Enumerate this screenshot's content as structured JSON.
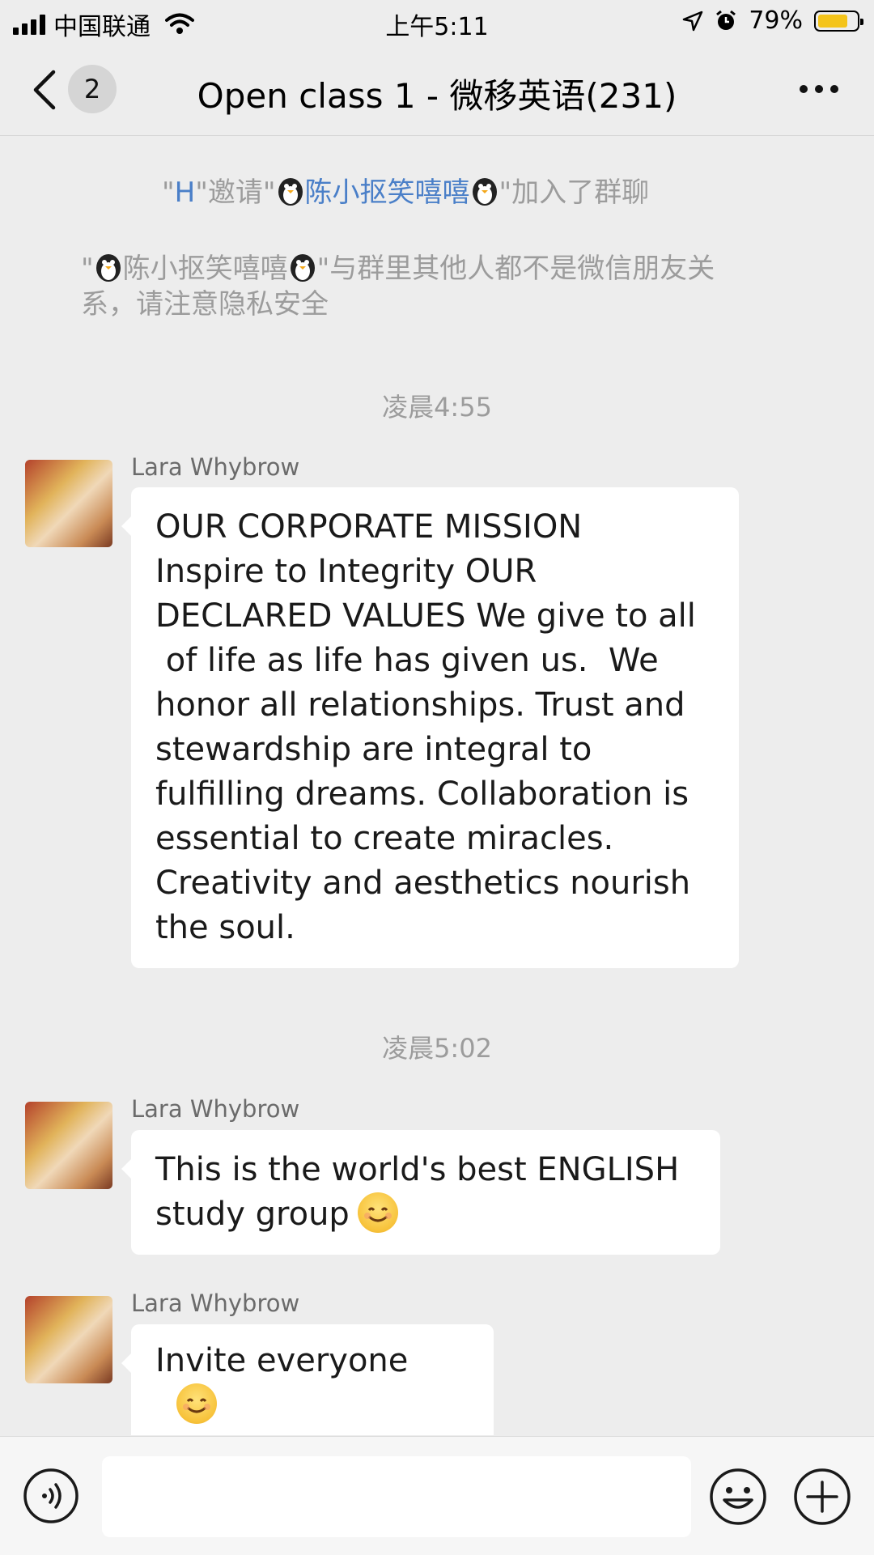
{
  "status_bar": {
    "carrier": "中国联通",
    "time": "上午5:11",
    "battery": "79%",
    "battery_level": 0.79
  },
  "nav": {
    "unread_count": "2",
    "title": "Open class 1 - 微移英语(231)"
  },
  "system_messages": {
    "invite": {
      "quote1": "\"",
      "inviter": "H",
      "middle": "\"邀请\"",
      "invitee": "陈小抠笑嘻嘻",
      "end": "\"加入了群聊"
    },
    "privacy": {
      "start": "\"",
      "name": "陈小抠笑嘻嘻",
      "text_line1": "\"与群里其他人都不是微信朋友关",
      "text_line2": "系，请注意隐私安全"
    }
  },
  "messages": [
    {
      "timestamp": "凌晨4:55",
      "sender": "Lara Whybrow",
      "lines": [
        "OUR CORPORATE MISSION",
        "Inspire to Integrity  OUR",
        "DECLARED VALUES  We give to all",
        " of life as life has given us.  We",
        "honor all relationships.  Trust and",
        "stewardship are integral to",
        "fulfilling dreams.  Collaboration is",
        "essential to create miracles.",
        "Creativity and aesthetics nourish",
        "the soul."
      ]
    },
    {
      "timestamp": "凌晨5:02",
      "sender": "Lara Whybrow",
      "lines": [
        "This is the world's best ENGLISH",
        "study group"
      ]
    },
    {
      "sender": "Lara Whybrow",
      "text": "Invite everyone"
    }
  ],
  "icons": {
    "signal": "signal-icon",
    "wifi": "wifi-icon",
    "location": "location-arrow-icon",
    "alarm": "alarm-icon",
    "battery": "battery-icon",
    "back": "chevron-left-icon",
    "more": "more-icon",
    "voice": "voice-icon",
    "emoji": "emoji-icon",
    "plus": "plus-icon",
    "smile": "smile-emoji-icon"
  },
  "colors": {
    "background": "#ededed",
    "link": "#4a7fc8",
    "battery_fill": "#f4c41a",
    "bubble": "#ffffff"
  }
}
